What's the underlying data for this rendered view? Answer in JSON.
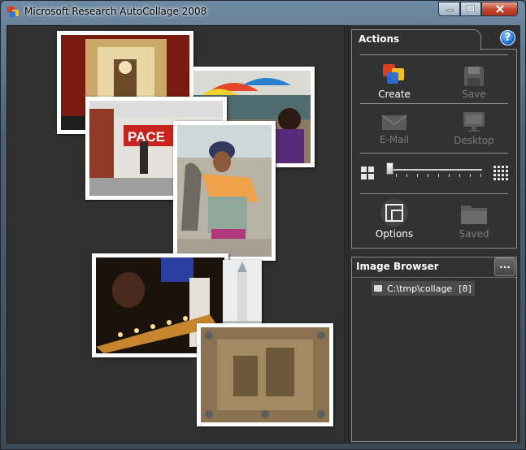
{
  "window": {
    "title": "Microsoft Research AutoCollage 2008"
  },
  "actions": {
    "title": "Actions",
    "buttons": {
      "create": "Create",
      "save": "Save",
      "email": "E-Mail",
      "desktop": "Desktop",
      "options": "Options",
      "saved": "Saved"
    },
    "slider": {
      "value_fraction": 0.03
    }
  },
  "image_browser": {
    "title": "Image Browser",
    "more_label": "...",
    "items": [
      {
        "path": "C:\\tmp\\collage",
        "count": "[8]"
      }
    ]
  },
  "colors": {
    "create_red": "#e23b1c",
    "create_yellow": "#f4c020",
    "create_blue": "#2a6bd8",
    "close_red": "#c2442a"
  },
  "icons": {
    "app": "app-icon",
    "help": "help-icon",
    "folder": "folder-icon"
  }
}
